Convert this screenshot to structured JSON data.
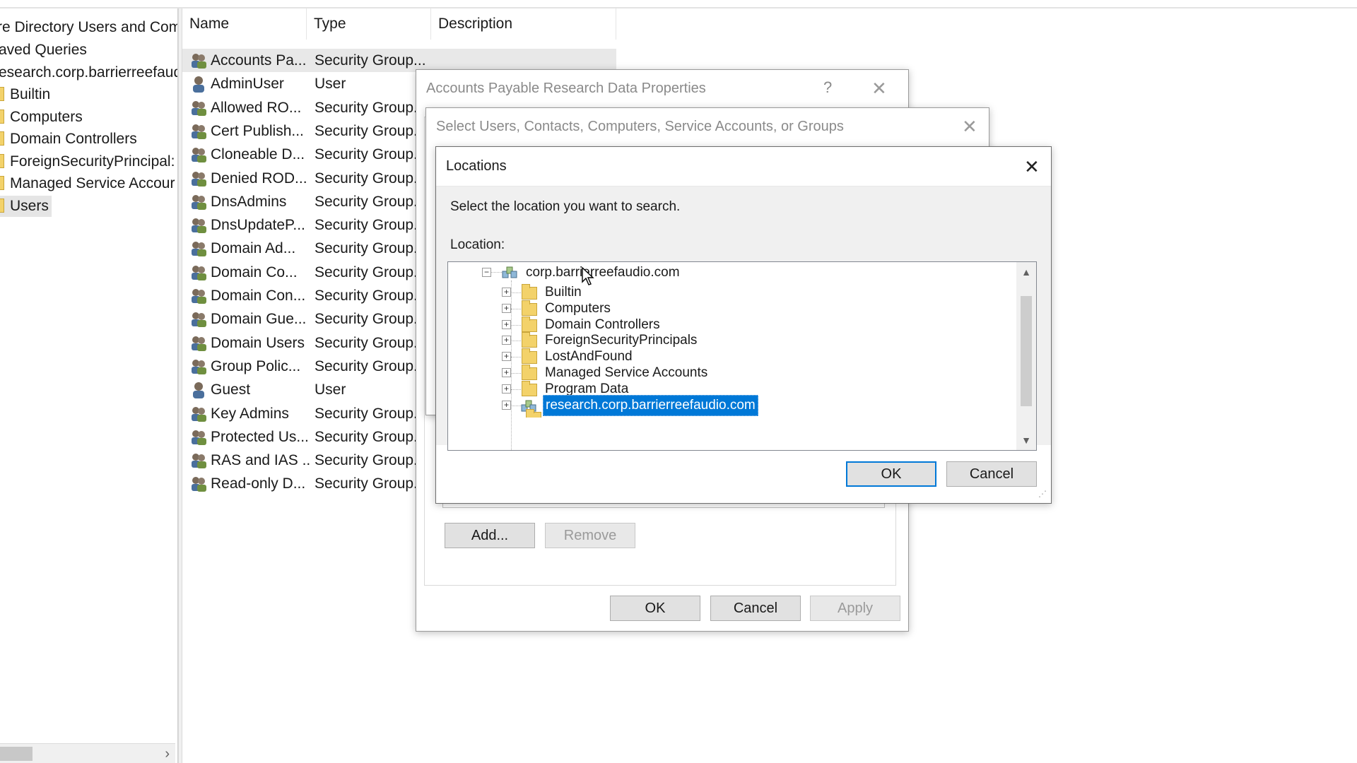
{
  "left_tree": {
    "items": [
      {
        "label": "re Directory Users and Com",
        "icon": "none"
      },
      {
        "label": "aved Queries",
        "icon": "none"
      },
      {
        "label": "esearch.corp.barrierreefaud",
        "icon": "none"
      },
      {
        "label": "Builtin",
        "icon": "folder-icon"
      },
      {
        "label": "Computers",
        "icon": "folder-icon"
      },
      {
        "label": "Domain Controllers",
        "icon": "folder-icon"
      },
      {
        "label": "ForeignSecurityPrincipal:",
        "icon": "folder-icon"
      },
      {
        "label": "Managed Service Accour",
        "icon": "folder-icon"
      },
      {
        "label": "Users",
        "icon": "folder-icon",
        "selected": true
      }
    ]
  },
  "list": {
    "columns": [
      "Name",
      "Type",
      "Description"
    ],
    "rows": [
      {
        "name": "Accounts Pa...",
        "type": "Security Group...",
        "icon": "group-icon",
        "selected": true
      },
      {
        "name": "AdminUser",
        "type": "User",
        "icon": "user-icon"
      },
      {
        "name": "Allowed RO...",
        "type": "Security Group...",
        "icon": "group-icon"
      },
      {
        "name": "Cert Publish...",
        "type": "Security Group...",
        "icon": "group-icon"
      },
      {
        "name": "Cloneable D...",
        "type": "Security Group...",
        "icon": "group-icon"
      },
      {
        "name": "Denied ROD...",
        "type": "Security Group...",
        "icon": "group-icon"
      },
      {
        "name": "DnsAdmins",
        "type": "Security Group...",
        "icon": "group-icon"
      },
      {
        "name": "DnsUpdateP...",
        "type": "Security Group...",
        "icon": "group-icon"
      },
      {
        "name": "Domain Ad...",
        "type": "Security Group...",
        "icon": "group-icon"
      },
      {
        "name": "Domain Co...",
        "type": "Security Group...",
        "icon": "group-icon"
      },
      {
        "name": "Domain Con...",
        "type": "Security Group...",
        "icon": "group-icon"
      },
      {
        "name": "Domain Gue...",
        "type": "Security Group...",
        "icon": "group-icon"
      },
      {
        "name": "Domain Users",
        "type": "Security Group...",
        "icon": "group-icon"
      },
      {
        "name": "Group Polic...",
        "type": "Security Group...",
        "icon": "group-icon"
      },
      {
        "name": "Guest",
        "type": "User",
        "icon": "user-icon"
      },
      {
        "name": "Key Admins",
        "type": "Security Group...",
        "icon": "group-icon"
      },
      {
        "name": "Protected Us...",
        "type": "Security Group...",
        "icon": "group-icon"
      },
      {
        "name": "RAS and IAS ...",
        "type": "Security Group...",
        "icon": "group-icon"
      },
      {
        "name": "Read-only D...",
        "type": "Security Group...",
        "icon": "group-icon"
      }
    ]
  },
  "properties_dialog": {
    "title": "Accounts Payable Research Data Properties",
    "help_glyph": "?",
    "add_label": "Add...",
    "remove_label": "Remove",
    "ok_label": "OK",
    "cancel_label": "Cancel",
    "apply_label": "Apply"
  },
  "select_dialog": {
    "title": "Select Users, Contacts, Computers, Service Accounts, or Groups"
  },
  "locations_dialog": {
    "title": "Locations",
    "instruction": "Select the location you want to search.",
    "location_label": "Location:",
    "root": {
      "label": "corp.barrierreefaudio.com",
      "icon": "domain-icon",
      "expander": "⊟"
    },
    "children": [
      {
        "label": "Builtin",
        "icon": "folder-icon"
      },
      {
        "label": "Computers",
        "icon": "folder-icon"
      },
      {
        "label": "Domain Controllers",
        "icon": "folder-icon"
      },
      {
        "label": "ForeignSecurityPrincipals",
        "icon": "folder-icon"
      },
      {
        "label": "LostAndFound",
        "icon": "folder-icon"
      },
      {
        "label": "Managed Service Accounts",
        "icon": "folder-icon"
      },
      {
        "label": "Program Data",
        "icon": "folder-icon"
      },
      {
        "label": "research.corp.barrierreefaudio.com",
        "icon": "domain-icon",
        "selected": true
      }
    ],
    "ok_label": "OK",
    "cancel_label": "Cancel"
  },
  "colors": {
    "selection": "#0078d7",
    "folder": "#f3d26a",
    "list_selection": "#e8e8e8"
  }
}
